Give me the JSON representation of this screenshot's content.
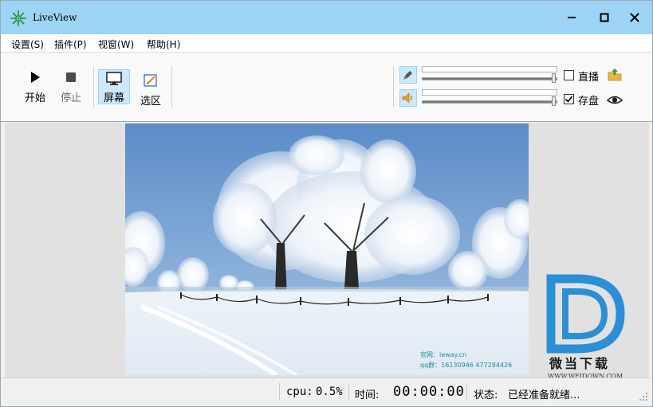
{
  "window": {
    "title": "LiveView"
  },
  "menu": {
    "items": [
      "设置(S)",
      "插件(P)",
      "视窗(W)",
      "帮助(H)"
    ]
  },
  "toolbar": {
    "start_label": "开始",
    "stop_label": "停止",
    "screen_label": "屏幕",
    "region_label": "选区",
    "mic_volume": 1.0,
    "speaker_volume": 1.0,
    "live_label": "直播",
    "live_checked": false,
    "save_label": "存盘",
    "save_checked": true
  },
  "preview": {
    "watermark_line1": "官网：ieway.cn",
    "watermark_line2": "qq群：16130946  477284426"
  },
  "site_watermark": {
    "name": "微当下载",
    "url": "WWW.WEIDOWN.COM"
  },
  "status": {
    "cpu_label": "cpu:",
    "cpu_value": "0.5%",
    "time_label": "时间:",
    "time_value": "00:00:00",
    "state_label": "状态:",
    "state_value": "已经准备就绪..."
  },
  "colors": {
    "titlebar": "#9dd3f5",
    "accent_active": "#cce8ff",
    "watermark_blue": "#2a8fd6"
  }
}
